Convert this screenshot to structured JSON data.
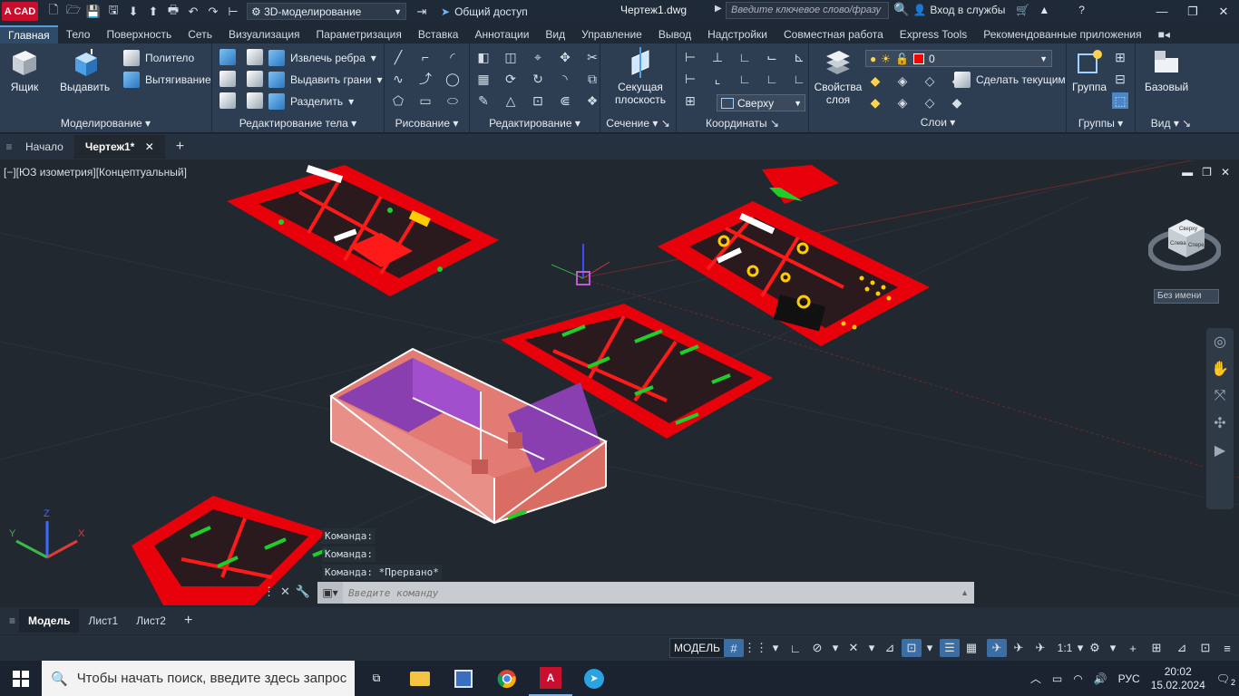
{
  "titlebar": {
    "logo_text": "A CAD",
    "workspace": "3D-моделирование",
    "share": "Общий доступ",
    "document": "Чертеж1.dwg",
    "search_placeholder": "Введите ключевое слово/фразу",
    "signin": "Вход в службы"
  },
  "ribbon_tabs": [
    "Главная",
    "Тело",
    "Поверхность",
    "Сеть",
    "Визуализация",
    "Параметризация",
    "Вставка",
    "Аннотации",
    "Вид",
    "Управление",
    "Вывод",
    "Надстройки",
    "Совместная работа",
    "Express Tools",
    "Рекомендованные приложения"
  ],
  "ribbon": {
    "box": "Ящик",
    "extrude": "Выдавить",
    "polysolid": "Политело",
    "presspull": "Вытягивание",
    "modeling": "Моделирование",
    "extract_edges": "Извлечь ребра",
    "extrude_faces": "Выдавить грани",
    "separate": "Разделить",
    "solid_edit": "Редактирование тела",
    "draw": "Рисование",
    "modify": "Редактирование",
    "section_plane": "Секущая плоскость",
    "section": "Сечение",
    "view_dir": "Сверху",
    "coordinates": "Координаты",
    "layer_props": "Свойства слоя",
    "layer_name": "0",
    "make_current": "Сделать текущим",
    "layers": "Слои",
    "group": "Группа",
    "groups": "Группы",
    "base": "Базовый",
    "view": "Вид"
  },
  "file_tabs": [
    "Начало",
    "Чертеж1*"
  ],
  "viewport": {
    "label": "[−][ЮЗ изометрия][Концептуальный]",
    "cube_name": "Без имени",
    "cube_faces": [
      "Сверху",
      "Спереди",
      "Слева"
    ]
  },
  "command": {
    "history": [
      "Команда:",
      "Команда:",
      "Команда: *Прервано*"
    ],
    "placeholder": "Введите команду"
  },
  "layout_tabs": [
    "Модель",
    "Лист1",
    "Лист2"
  ],
  "status": {
    "model": "МОДЕЛЬ",
    "scale": "1:1"
  },
  "taskbar": {
    "search": "Чтобы начать поиск, введите здесь запрос",
    "lang": "РУС",
    "time": "20:02",
    "date": "15.02.2024",
    "notifications": "2"
  }
}
